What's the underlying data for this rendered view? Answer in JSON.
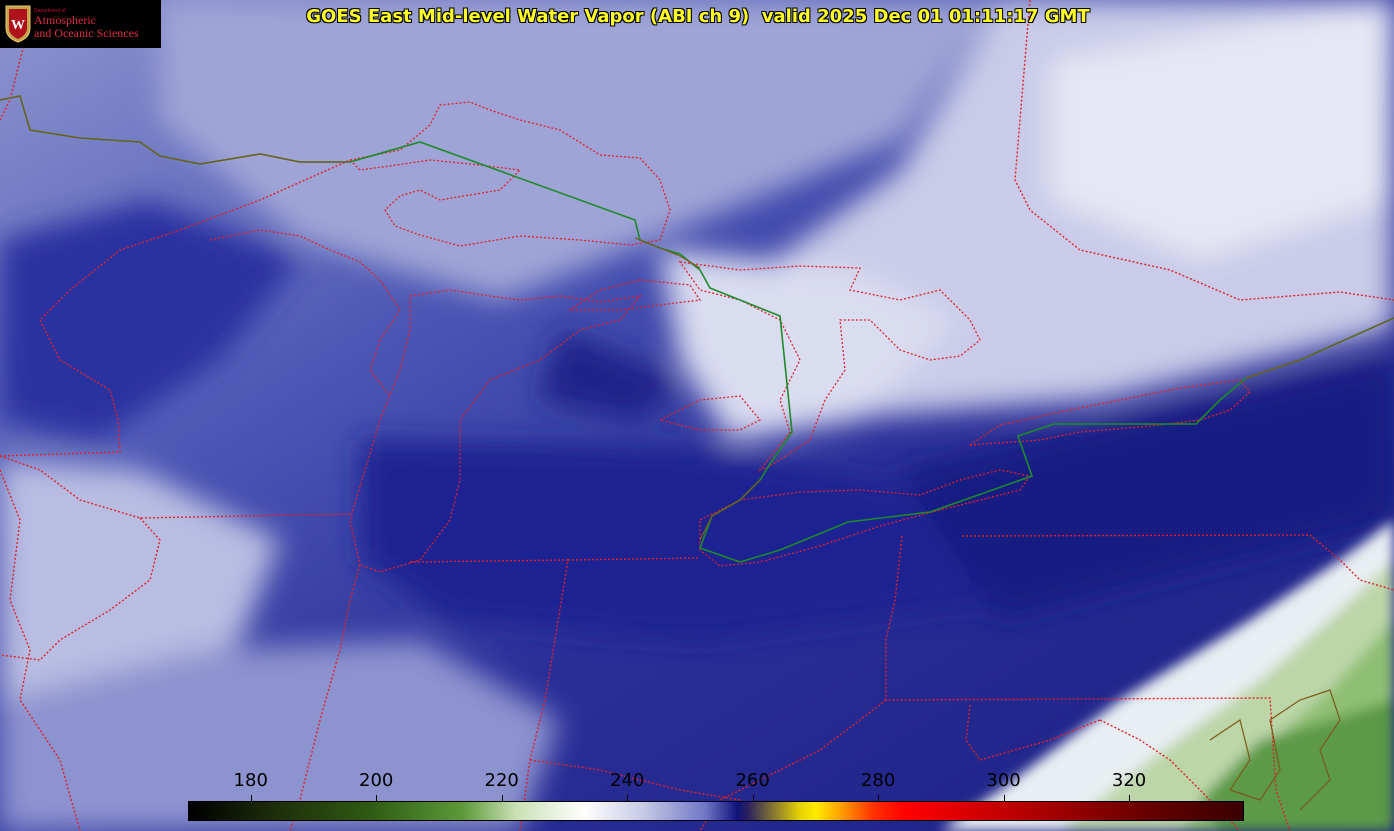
{
  "title": "GOES East Mid-level Water Vapor (ABI ch 9)  valid 2025 Dec 01 01:11:17 GMT",
  "logo": {
    "department_prefix": "Department of",
    "line1": "Atmospheric",
    "line2": "and Oceanic Sciences"
  },
  "colorbar": {
    "ticks": [
      "180",
      "200",
      "220",
      "240",
      "260",
      "280",
      "300",
      "320"
    ],
    "min": 170,
    "max": 338
  },
  "colors": {
    "title_text": "#ffff26",
    "boundary_lines": "#e0202a",
    "international_border": "#1e8a2a"
  }
}
